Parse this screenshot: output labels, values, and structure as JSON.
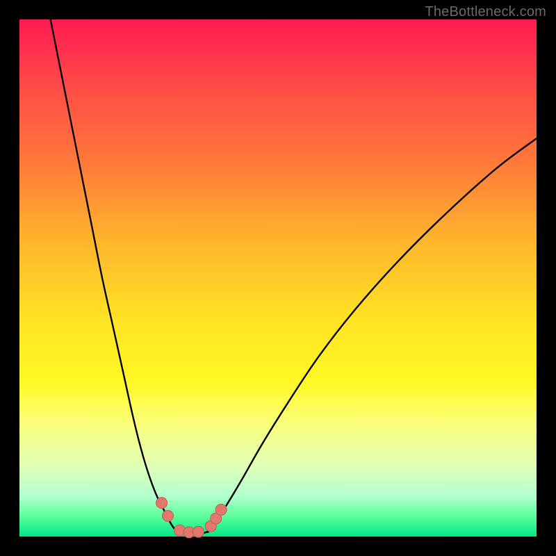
{
  "watermark": "TheBottleneck.com",
  "colors": {
    "frame_bg": "#000000",
    "curve_stroke": "#000000",
    "marker_fill": "#e2786d",
    "marker_stroke": "#c15a52",
    "gradient_top": "#ff1a52",
    "gradient_bottom": "#00e886"
  },
  "chart_data": {
    "type": "line",
    "title": "",
    "xlabel": "",
    "ylabel": "",
    "xlim": [
      0,
      100
    ],
    "ylim": [
      0,
      100
    ],
    "grid": false,
    "series": [
      {
        "name": "left-branch",
        "x": [
          6,
          8,
          10,
          12,
          14,
          16,
          18,
          20,
          22,
          23.5,
          25,
          26.5,
          28,
          29,
          30,
          31
        ],
        "y": [
          100,
          90,
          80,
          70,
          60,
          50,
          41,
          32,
          23,
          17,
          12,
          8,
          5,
          3,
          1.5,
          1
        ]
      },
      {
        "name": "floor",
        "x": [
          31,
          33,
          35,
          36.5
        ],
        "y": [
          1,
          0.5,
          0.5,
          1
        ]
      },
      {
        "name": "right-branch",
        "x": [
          36.5,
          38,
          40,
          43,
          47,
          52,
          58,
          65,
          73,
          82,
          92,
          100
        ],
        "y": [
          1,
          3,
          6,
          11,
          18,
          26,
          35,
          44,
          53,
          62,
          71,
          77
        ]
      }
    ],
    "markers": [
      {
        "x": 27.5,
        "y": 6.5
      },
      {
        "x": 28.7,
        "y": 4.0
      },
      {
        "x": 31.0,
        "y": 1.2
      },
      {
        "x": 32.8,
        "y": 0.8
      },
      {
        "x": 34.6,
        "y": 0.9
      },
      {
        "x": 37.0,
        "y": 2.0
      },
      {
        "x": 38.0,
        "y": 3.5
      },
      {
        "x": 39.0,
        "y": 5.2
      }
    ]
  }
}
